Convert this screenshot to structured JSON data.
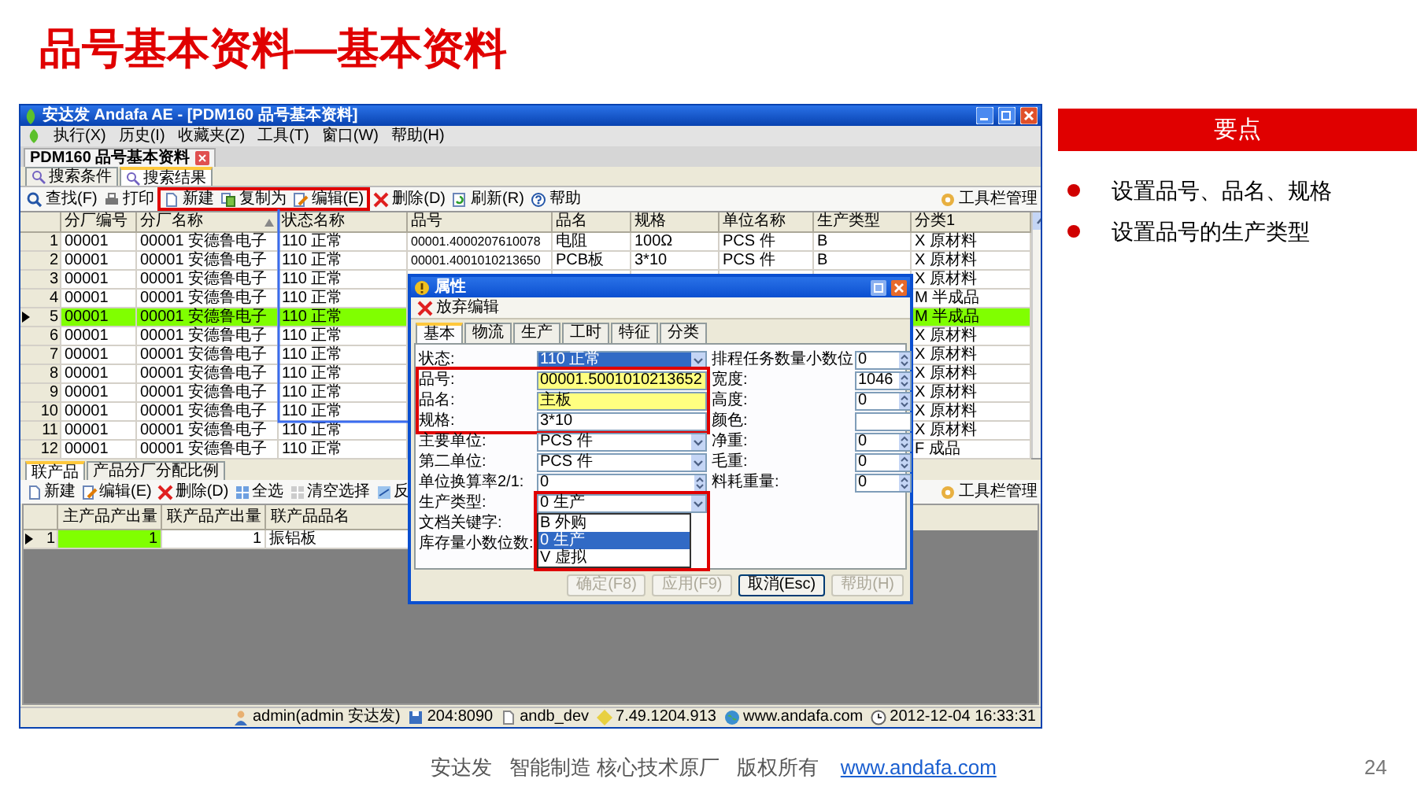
{
  "slide_title": "品号基本资料—基本资料",
  "window": {
    "title": "安达发 Andafa AE - [PDM160 品号基本资料]"
  },
  "menu": [
    "执行(X)",
    "历史(I)",
    "收藏夹(Z)",
    "工具(T)",
    "窗口(W)",
    "帮助(H)"
  ],
  "doc_tab": {
    "label": "PDM160 品号基本资料"
  },
  "view_tabs": [
    {
      "label": "搜索条件",
      "selected": false
    },
    {
      "label": "搜索结果",
      "selected": true
    }
  ],
  "toolbar": {
    "items": [
      {
        "label": "查找(F)",
        "framed": false
      },
      {
        "label": "打印",
        "framed": false
      },
      {
        "label": "新建",
        "framed": true
      },
      {
        "label": "复制为",
        "framed": true
      },
      {
        "label": "编辑(E)",
        "framed": true
      },
      {
        "label": "删除(D)",
        "framed": false
      },
      {
        "label": "刷新(R)",
        "framed": false
      },
      {
        "label": "帮助",
        "framed": false
      }
    ],
    "manager": "工具栏管理"
  },
  "grid": {
    "columns": [
      {
        "label": "分厂编号",
        "sorted": false
      },
      {
        "label": "分厂名称",
        "sorted": true
      },
      {
        "label": "状态名称",
        "sorted": false
      },
      {
        "label": "品号",
        "sorted": false
      },
      {
        "label": "品名",
        "sorted": false
      },
      {
        "label": "规格",
        "sorted": false
      },
      {
        "label": "单位名称",
        "sorted": false
      },
      {
        "label": "生产类型",
        "sorted": false
      },
      {
        "label": "分类1",
        "sorted": false
      }
    ],
    "rows": [
      {
        "no": "1",
        "selected": false,
        "cells": [
          "00001",
          "00001 安德鲁电子",
          "110 正常",
          "00001.4000207610078",
          "电阻",
          "100Ω",
          "PCS 件",
          "B",
          "X 原材料"
        ]
      },
      {
        "no": "2",
        "selected": false,
        "cells": [
          "00001",
          "00001 安德鲁电子",
          "110 正常",
          "00001.4001010213650",
          "PCB板",
          "3*10",
          "PCS 件",
          "B",
          "X 原材料"
        ]
      },
      {
        "no": "3",
        "selected": false,
        "cells": [
          "00001",
          "00001 安德鲁电子",
          "110 正常",
          null,
          null,
          null,
          null,
          null,
          "X 原材料"
        ]
      },
      {
        "no": "4",
        "selected": false,
        "cells": [
          "00001",
          "00001 安德鲁电子",
          "110 正常",
          null,
          null,
          null,
          null,
          null,
          "M 半成品"
        ]
      },
      {
        "no": "5",
        "selected": true,
        "cells": [
          "00001",
          "00001 安德鲁电子",
          "110 正常",
          null,
          null,
          null,
          null,
          null,
          "M 半成品"
        ]
      },
      {
        "no": "6",
        "selected": false,
        "cells": [
          "00001",
          "00001 安德鲁电子",
          "110 正常",
          null,
          null,
          null,
          null,
          null,
          "X 原材料"
        ]
      },
      {
        "no": "7",
        "selected": false,
        "cells": [
          "00001",
          "00001 安德鲁电子",
          "110 正常",
          null,
          null,
          null,
          null,
          null,
          "X 原材料"
        ]
      },
      {
        "no": "8",
        "selected": false,
        "cells": [
          "00001",
          "00001 安德鲁电子",
          "110 正常",
          null,
          null,
          null,
          null,
          null,
          "X 原材料"
        ]
      },
      {
        "no": "9",
        "selected": false,
        "cells": [
          "00001",
          "00001 安德鲁电子",
          "110 正常",
          null,
          null,
          null,
          null,
          null,
          "X 原材料"
        ]
      },
      {
        "no": "10",
        "selected": false,
        "cells": [
          "00001",
          "00001 安德鲁电子",
          "110 正常",
          null,
          null,
          null,
          null,
          null,
          "X 原材料"
        ]
      },
      {
        "no": "11",
        "selected": false,
        "cells": [
          "00001",
          "00001 安德鲁电子",
          "110 正常",
          null,
          null,
          null,
          null,
          null,
          "X 原材料"
        ]
      },
      {
        "no": "12",
        "selected": false,
        "cells": [
          "00001",
          "00001 安德鲁电子",
          "110 正常",
          null,
          null,
          null,
          null,
          null,
          "F 成品"
        ]
      }
    ]
  },
  "detail": {
    "tabs": [
      {
        "label": "联产品",
        "selected": true
      },
      {
        "label": "产品分厂分配比例",
        "selected": false
      }
    ],
    "toolbar": {
      "items": [
        "新建",
        "编辑(E)",
        "删除(D)",
        "全选",
        "清空选择",
        "反"
      ],
      "manager": "工具栏管理"
    },
    "columns": [
      "主产品产出量",
      "联产品产出量",
      "联产品品名"
    ],
    "rows": [
      {
        "no": "1",
        "selected": true,
        "cells": [
          "1",
          "1",
          "振铝板"
        ]
      }
    ]
  },
  "status_bar": [
    "admin(admin 安达发)",
    "204:8090",
    "andb_dev",
    "7.49.1204.913",
    "www.andafa.com",
    "2012-12-04 16:33:31"
  ],
  "dialog": {
    "title": "属性",
    "toolbar": "放弃编辑",
    "tabs": [
      {
        "label": "基本",
        "selected": true
      },
      {
        "label": "物流",
        "selected": false
      },
      {
        "label": "生产",
        "selected": false
      },
      {
        "label": "工时",
        "selected": false
      },
      {
        "label": "特征",
        "selected": false
      },
      {
        "label": "分类",
        "selected": false
      }
    ],
    "left_fields": [
      {
        "label": "状态:",
        "kind": "select",
        "value": "110 正常",
        "highlighted": false,
        "focused": true,
        "framed": false
      },
      {
        "label": "品号:",
        "kind": "text",
        "value": "00001.5001010213652",
        "highlighted": true,
        "focused": false,
        "framed": true
      },
      {
        "label": "品名:",
        "kind": "text",
        "value": "主板",
        "highlighted": true,
        "focused": false,
        "framed": true
      },
      {
        "label": "规格:",
        "kind": "text",
        "value": "3*10",
        "highlighted": false,
        "focused": false,
        "framed": true
      },
      {
        "label": "主要单位:",
        "kind": "select",
        "value": "PCS 件",
        "highlighted": false,
        "focused": false,
        "framed": false
      },
      {
        "label": "第二单位:",
        "kind": "select",
        "value": "PCS 件",
        "highlighted": false,
        "focused": false,
        "framed": false
      },
      {
        "label": "单位换算率2/1:",
        "kind": "spin",
        "value": "0",
        "highlighted": false,
        "focused": false,
        "framed": false
      },
      {
        "label": "生产类型:",
        "kind": "dropdown",
        "value": "0 生产",
        "highlighted": false,
        "focused": false,
        "framed": true,
        "options": [
          {
            "label": "B 外购",
            "selected": false
          },
          {
            "label": "0 生产",
            "selected": true
          },
          {
            "label": "V 虚拟",
            "selected": false
          }
        ]
      },
      {
        "label": "文档关键字:",
        "kind": "blank"
      },
      {
        "label": "库存量小数位数:",
        "kind": "blank"
      }
    ],
    "right_fields": [
      {
        "label": "排程任务数量小数位",
        "kind": "spin",
        "value": "0"
      },
      {
        "label": "宽度:",
        "kind": "spin",
        "value": "1046"
      },
      {
        "label": "高度:",
        "kind": "spin",
        "value": "0"
      },
      {
        "label": "颜色:",
        "kind": "text"
      },
      {
        "label": "净重:",
        "kind": "spin",
        "value": "0"
      },
      {
        "label": "毛重:",
        "kind": "spin",
        "value": "0"
      },
      {
        "label": "料耗重量:",
        "kind": "spin",
        "value": "0"
      }
    ],
    "buttons": [
      {
        "label": "确定(F8)",
        "disabled": true
      },
      {
        "label": "应用(F9)",
        "disabled": true
      },
      {
        "label": "取消(Esc)",
        "disabled": false
      },
      {
        "label": "帮助(H)",
        "disabled": true
      }
    ]
  },
  "key_points": {
    "title": "要点",
    "items": [
      "设置品号、品名、规格",
      "设置品号的生产类型"
    ]
  },
  "footer": {
    "text": "安达发   智能制造 核心技术原厂   版权所有",
    "link": "www.andafa.com",
    "page": "24"
  }
}
